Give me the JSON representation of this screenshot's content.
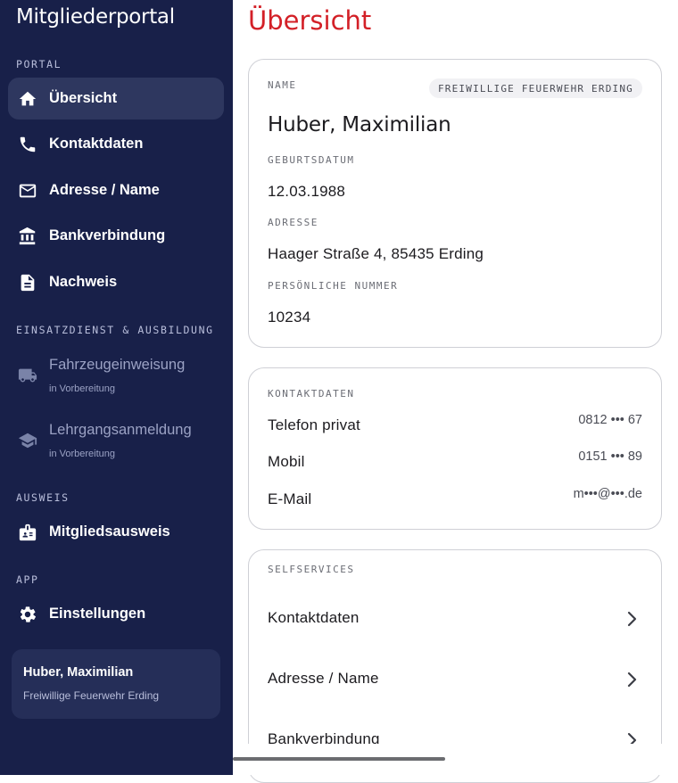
{
  "sidebar": {
    "app_title": "Mitgliederportal",
    "sections": {
      "portal": "PORTAL",
      "einsatz": "EINSATZDIENST & AUSBILDUNG",
      "ausweis": "AUSWEIS",
      "app": "APP"
    },
    "items": {
      "uebersicht": {
        "label": "Übersicht",
        "icon": "home-icon",
        "active": true
      },
      "kontaktdaten": {
        "label": "Kontaktdaten",
        "icon": "phone-icon"
      },
      "adresse": {
        "label": "Adresse / Name",
        "icon": "mail-icon"
      },
      "bank": {
        "label": "Bankverbindung",
        "icon": "bank-icon"
      },
      "nachweis": {
        "label": "Nachweis",
        "icon": "document-icon"
      },
      "fahrzeug": {
        "label": "Fahrzeugeinweisung",
        "sub": "in Vorbereitung",
        "icon": "truck-icon",
        "disabled": true
      },
      "lehrgang": {
        "label": "Lehrgangsanmeldung",
        "sub": "in Vorbereitung",
        "icon": "school-icon",
        "disabled": true
      },
      "ausweis": {
        "label": "Mitgliedsausweis",
        "icon": "badge-icon"
      },
      "einstellungen": {
        "label": "Einstellungen",
        "icon": "gear-icon"
      }
    },
    "user": {
      "name": "Huber, Maximilian",
      "org": "Freiwillige Feuerwehr Erding"
    }
  },
  "main": {
    "title": "Übersicht",
    "profile": {
      "name_label": "NAME",
      "org_chip": "FREIWILLIGE FEUERWEHR ERDING",
      "name": "Huber, Maximilian",
      "birth_label": "GEBURTSDATUM",
      "birth": "12.03.1988",
      "address_label": "ADRESSE",
      "address": "Haager Straße 4, 85435 Erding",
      "number_label": "PERSÖNLICHE NUMMER",
      "number": "10234"
    },
    "contact": {
      "heading": "KONTAKTDATEN",
      "phone_label": "Telefon privat",
      "phone": "0812 ••• 67",
      "mobile_label": "Mobil",
      "mobile": "0151 ••• 89",
      "email_label": "E-Mail",
      "email": "m•••@•••.de"
    },
    "selfservices": {
      "heading": "SELFSERVICES",
      "items": [
        "Kontaktdaten",
        "Adresse / Name",
        "Bankverbindung"
      ]
    }
  },
  "colors": {
    "sidebar_bg": "#182049",
    "active_item_bg": "#2e375f",
    "title_red": "#d32027",
    "card_border": "#cfd0d6"
  }
}
